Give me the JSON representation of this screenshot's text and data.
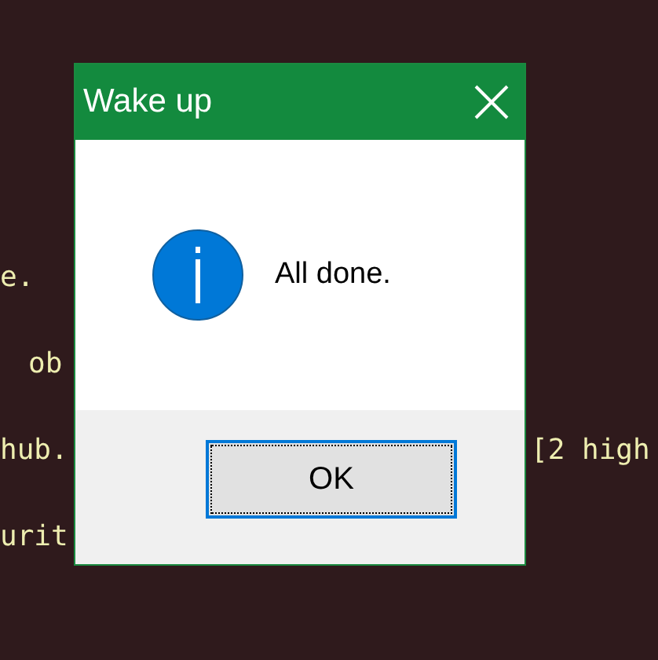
{
  "terminal": {
    "lines": [
      {
        "left": "e."
      },
      {
        "left": "ob"
      },
      {
        "left": "hub.",
        "right": "[2 high"
      },
      {
        "left": "urit"
      }
    ]
  },
  "dialog": {
    "title": "Wake up",
    "message": "All done.",
    "buttons": [
      "OK"
    ]
  }
}
